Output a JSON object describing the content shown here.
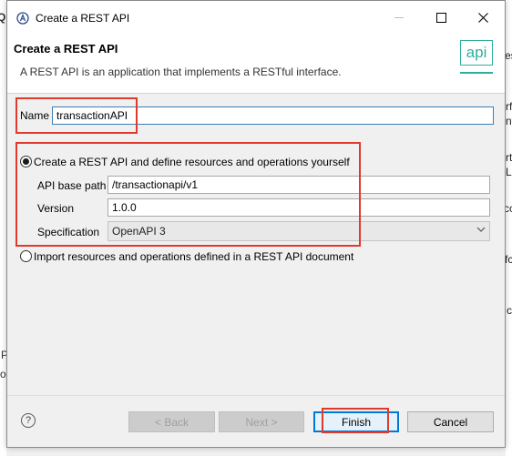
{
  "background": {
    "left_fragments": [
      "Qu",
      "P",
      "o"
    ],
    "right_fragments": [
      "es",
      "rf",
      "nt",
      "rt",
      "L",
      "co",
      "fc",
      "c"
    ]
  },
  "dialog": {
    "title": "Create a REST API",
    "window_controls": {
      "minimize": "—",
      "maximize": "☐",
      "close": "✕"
    },
    "banner": {
      "title": "Create a REST API",
      "description": "A REST API is an application that implements a RESTful interface.",
      "logo_text": "api"
    },
    "name_field": {
      "label": "Name",
      "value": "transactionAPI"
    },
    "options": {
      "define_yourself": {
        "label": "Create a REST API and define resources and operations yourself",
        "selected": true
      },
      "import_document": {
        "label": "Import resources and operations defined in a REST API document",
        "selected": false
      }
    },
    "fields": {
      "base_path": {
        "label": "API base path",
        "value": "/transactionapi/v1"
      },
      "version": {
        "label": "Version",
        "value": "1.0.0"
      },
      "specification": {
        "label": "Specification",
        "value": "OpenAPI 3"
      }
    },
    "buttons": {
      "help": "?",
      "back": "< Back",
      "next": "Next >",
      "finish": "Finish",
      "cancel": "Cancel"
    }
  },
  "colors": {
    "annotation": "#e03a2c",
    "accent": "#2eaf9e",
    "focus": "#0078d7"
  }
}
